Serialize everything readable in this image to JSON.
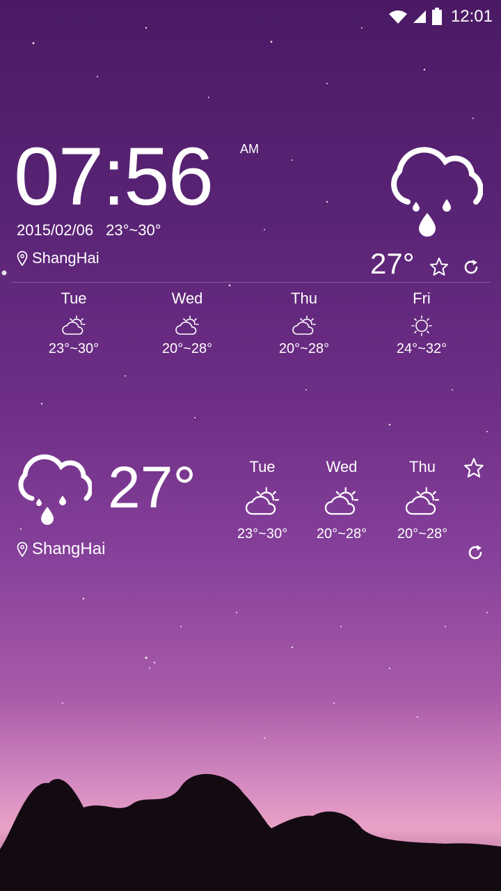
{
  "status": {
    "time": "12:01"
  },
  "widget1": {
    "time": "07:56",
    "ampm": "AM",
    "date": "2015/02/06",
    "range": "23°~30°",
    "location": "ShangHai",
    "current_temp": "27°",
    "forecast": [
      {
        "day": "Tue",
        "range": "23°~30°",
        "icon": "partly-cloudy-icon"
      },
      {
        "day": "Wed",
        "range": "20°~28°",
        "icon": "partly-cloudy-icon"
      },
      {
        "day": "Thu",
        "range": "20°~28°",
        "icon": "partly-cloudy-icon"
      },
      {
        "day": "Fri",
        "range": "24°~32°",
        "icon": "sunny-icon"
      }
    ]
  },
  "widget2": {
    "current_temp": "27°",
    "location": "ShangHai",
    "forecast": [
      {
        "day": "Tue",
        "range": "23°~30°",
        "icon": "partly-cloudy-icon"
      },
      {
        "day": "Wed",
        "range": "20°~28°",
        "icon": "partly-cloudy-icon"
      },
      {
        "day": "Thu",
        "range": "20°~28°",
        "icon": "partly-cloudy-icon"
      }
    ]
  }
}
